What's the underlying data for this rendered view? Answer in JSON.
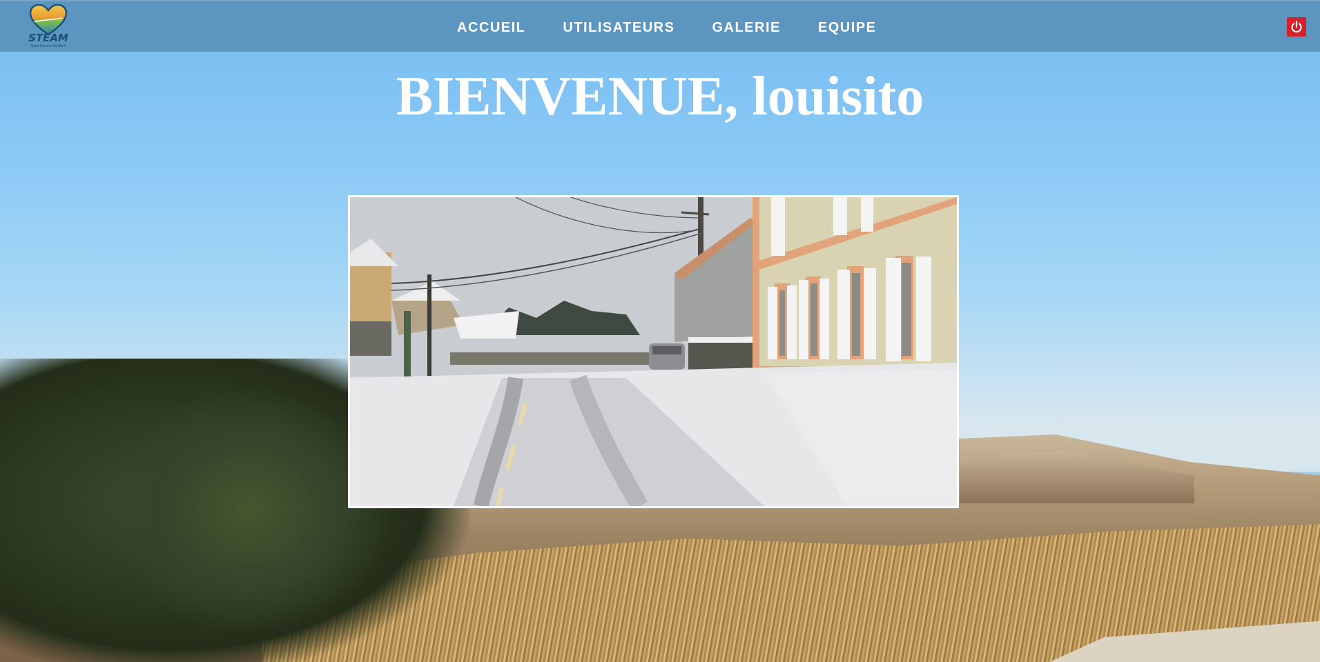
{
  "app": {
    "logo_text": "STEAM",
    "logo_subtext": "Saint-Etienne-Au-Mont"
  },
  "nav": {
    "items": [
      {
        "label": "ACCUEIL"
      },
      {
        "label": "UTILISATEURS"
      },
      {
        "label": "GALERIE"
      },
      {
        "label": "EQUIPE"
      }
    ],
    "logout_icon": "power-icon"
  },
  "main": {
    "welcome_text": "BIENVENUE, louisito"
  },
  "colors": {
    "navbar": "#568cb4",
    "logout": "#d6202a",
    "text": "#ffffff"
  }
}
